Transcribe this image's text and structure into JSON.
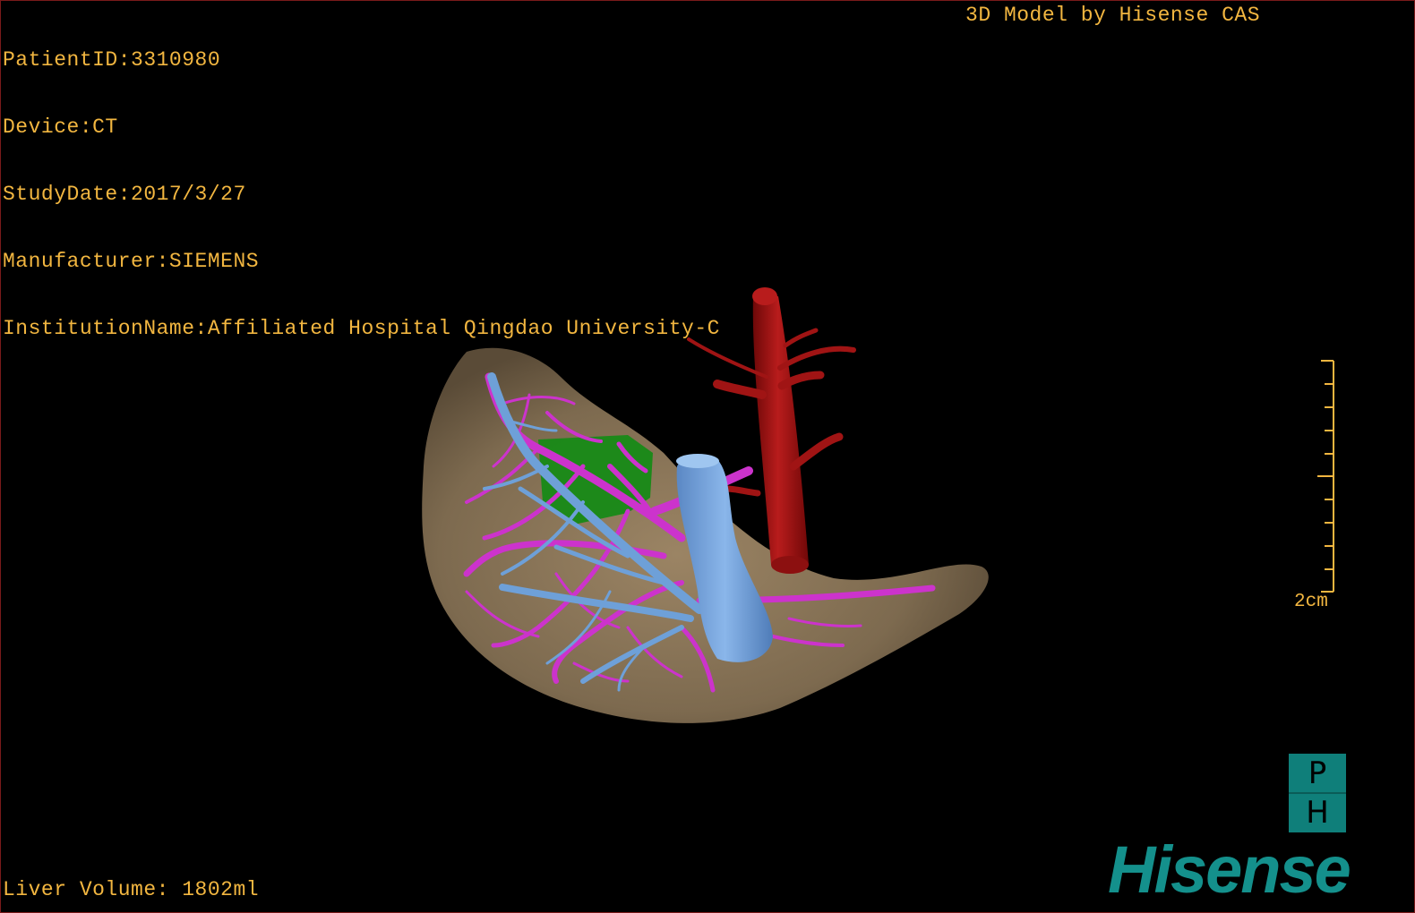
{
  "info": {
    "patient_id": "PatientID:3310980",
    "device": "Device:CT",
    "study_date": "StudyDate:2017/3/27",
    "manufacturer": "Manufacturer:SIEMENS",
    "institution": "InstitutionName:Affiliated Hospital Qingdao University-C"
  },
  "credit": "3D Model by Hisense CAS",
  "liver_volume": "Liver Volume: 1802ml",
  "scale": {
    "label": "2cm"
  },
  "orientation": {
    "top": "P",
    "bottom": "H"
  },
  "brand": "Hisense",
  "colors": {
    "text": "#f2b640",
    "liver": "#8a7558",
    "hepatic_vein": "#6ea0d8",
    "portal_vein": "#cc33cc",
    "artery": "#a01414",
    "tumor": "#1a8a1a",
    "brand": "#14908c"
  },
  "icons": [
    "liver-model",
    "scale-bar-icon",
    "orientation-cube-icon",
    "hisense-logo"
  ]
}
